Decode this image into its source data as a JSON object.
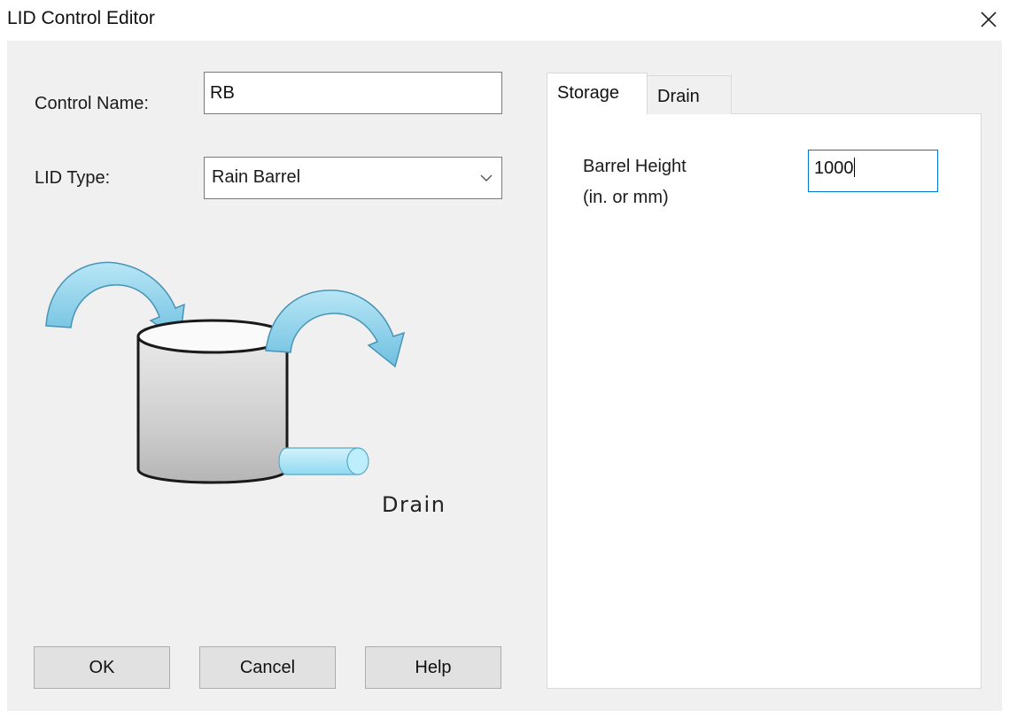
{
  "window": {
    "title": "LID Control Editor",
    "close_icon": "close-icon"
  },
  "form": {
    "control_name_label": "Control Name:",
    "control_name_value": "RB",
    "lid_type_label": "LID Type:",
    "lid_type_value": "Rain Barrel",
    "lid_type_icon": "chevron-down-icon"
  },
  "illustration": {
    "drain_label": "Drain",
    "colors": {
      "arrow": "#8fd3ef",
      "arrow_outline": "#4a93b5",
      "barrel": "#d4d4d4",
      "pipe": "#a6e4f7"
    }
  },
  "buttons": {
    "ok": "OK",
    "cancel": "Cancel",
    "help": "Help"
  },
  "tabs": [
    {
      "label": "Storage",
      "active": true
    },
    {
      "label": "Drain",
      "active": false
    }
  ],
  "storage": {
    "barrel_height_label_line1": "Barrel Height",
    "barrel_height_label_line2": "(in. or mm)",
    "barrel_height_value": "1000"
  }
}
